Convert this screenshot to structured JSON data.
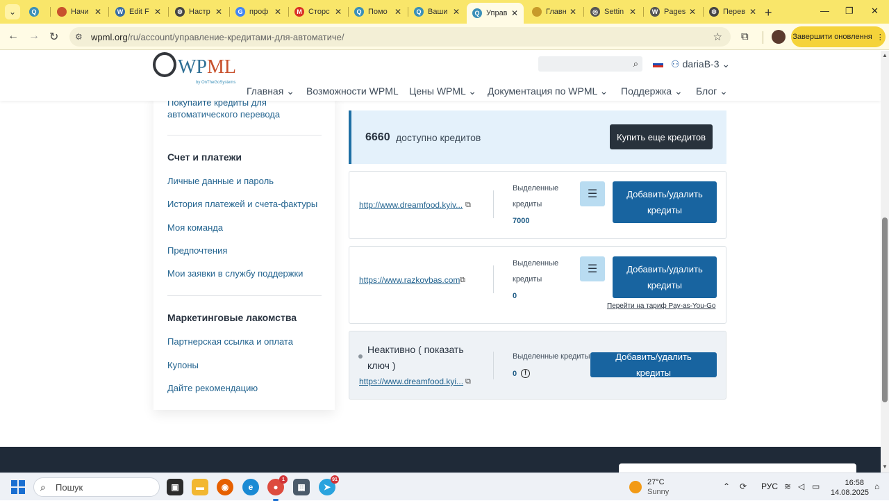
{
  "browser": {
    "tabs": [
      {
        "title": "",
        "favicon": "wpml-icon",
        "color": "#3a8fb8",
        "active": false
      },
      {
        "title": "Начи",
        "favicon": "bookmark-icon",
        "color": "#c8512d",
        "active": false
      },
      {
        "title": "Edit F",
        "favicon": "wordpress-icon",
        "color": "#3a6ea5",
        "active": false
      },
      {
        "title": "Настр",
        "favicon": "settings-icon",
        "color": "#444444",
        "active": false
      },
      {
        "title": "проф",
        "favicon": "google-icon",
        "color": "#4285f4",
        "active": false
      },
      {
        "title": "Сторс",
        "favicon": "gmail-icon",
        "color": "#d93025",
        "active": false
      },
      {
        "title": "Помо",
        "favicon": "wpml-icon",
        "color": "#3a8fb8",
        "active": false
      },
      {
        "title": "Ваши",
        "favicon": "wpml-icon",
        "color": "#3a8fb8",
        "active": false
      },
      {
        "title": "Управ",
        "favicon": "wpml-icon",
        "color": "#3a8fb8",
        "active": true
      },
      {
        "title": "Главн",
        "favicon": "page-icon",
        "color": "#c79a2a",
        "active": false
      },
      {
        "title": "Settin",
        "favicon": "globe-icon",
        "color": "#555555",
        "active": false
      },
      {
        "title": "Pages",
        "favicon": "wordpress-icon",
        "color": "#555555",
        "active": false
      },
      {
        "title": "Перев",
        "favicon": "settings-icon",
        "color": "#444444",
        "active": false
      }
    ],
    "url_host": "wpml.org",
    "url_path": "/ru/account/управление-кредитами-для-автоматиче/",
    "update_button": "Завершити оновлення"
  },
  "header": {
    "logo_text_a": "WP",
    "logo_text_b": "ML",
    "logo_by": "by OnTheGoSystems",
    "username": "dariaB-3",
    "nav": [
      "Главная",
      "Возможности WPML",
      "Цены WPML",
      "Документация по WPML",
      "Поддержка",
      "Блог"
    ]
  },
  "sidebar": {
    "top_link": "Покупайте кредиты для автоматического перевода",
    "section1_title": "Счет и платежи",
    "section1_links": [
      "Личные данные и пароль",
      "История платежей и счета-фактуры",
      "Моя команда",
      "Предпочтения",
      "Мои заявки в службу поддержки"
    ],
    "section2_title": "Маркетинговые лакомства",
    "section2_links": [
      "Партнерская ссылка и оплата",
      "Купоны",
      "Дайте рекомендацию"
    ]
  },
  "credits": {
    "available": "6660",
    "available_label": "доступно кредитов",
    "buy_button": "Купить еще кредитов"
  },
  "sites": [
    {
      "url": "http://www.dreamfood.kyiv...",
      "alloc_label": "Выделенные кредиты",
      "alloc_value": "7000",
      "button": "Добавить/удалить кредиты"
    },
    {
      "url": "https://www.razkovbas.com",
      "alloc_label": "Выделенные кредиты",
      "alloc_value": "0",
      "button": "Добавить/удалить кредиты",
      "payg_link": "Перейти на тариф Pay-as-You-Go"
    },
    {
      "status": "Неактивно ( показать ключ )",
      "url": "https://www.dreamfood.kyi...",
      "alloc_label": "Выделенные кредиты",
      "alloc_value": "0",
      "button": "Добавить/удалить кредиты"
    }
  ],
  "taskbar": {
    "search_placeholder": "Пошук",
    "weather_temp": "27°C",
    "weather_cond": "Sunny",
    "lang": "РУС",
    "time": "16:58",
    "date": "14.08.2025",
    "chrome_badge": "1",
    "telegram_badge": "91"
  }
}
